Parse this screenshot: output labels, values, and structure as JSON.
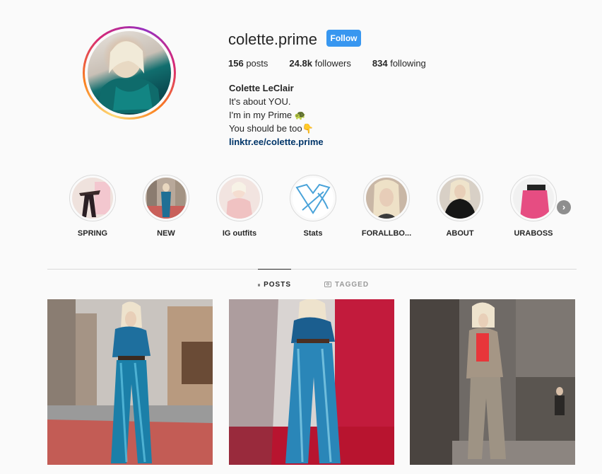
{
  "profile": {
    "username": "colette.prime",
    "follow_label": "Follow",
    "stats": [
      {
        "value": "156",
        "label": "posts"
      },
      {
        "value": "24.8k",
        "label": "followers"
      },
      {
        "value": "834",
        "label": "following"
      }
    ],
    "bio": {
      "name": "Colette LeClair",
      "lines": [
        "It's about YOU.",
        "I'm in my Prime 🐢",
        "You should be too👇"
      ],
      "link": "linktr.ee/colette.prime"
    }
  },
  "highlights": [
    {
      "label": "SPRING"
    },
    {
      "label": "NEW"
    },
    {
      "label": "IG outfits"
    },
    {
      "label": "Stats"
    },
    {
      "label": "FORALLBO..."
    },
    {
      "label": "ABOUT"
    },
    {
      "label": "URABOSS"
    }
  ],
  "tabs": {
    "posts": "POSTS",
    "tagged": "TAGGED"
  },
  "colors": {
    "follow": "#3897f0",
    "link": "#003569"
  },
  "icons": [
    "grid-icon",
    "tag-icon",
    "chevron-right-icon"
  ]
}
